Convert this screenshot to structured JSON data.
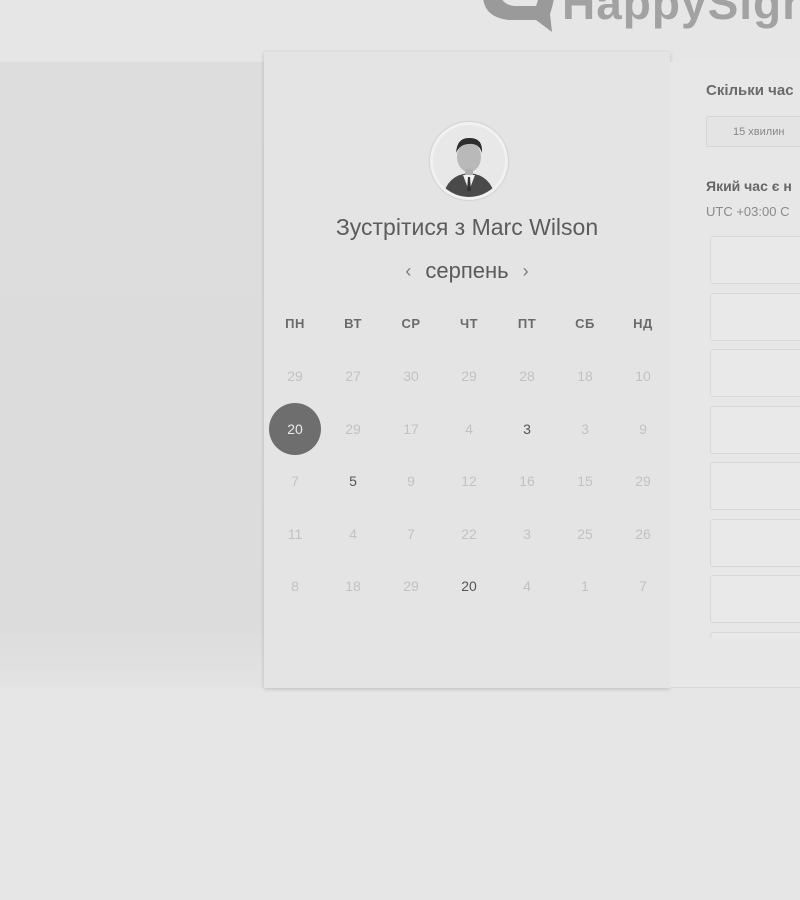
{
  "brand": {
    "name": "HappySign"
  },
  "host": {
    "title": "Зустрітися з Marc Wilson",
    "avatar_icon": "person-avatar-icon"
  },
  "calendar": {
    "month": "серпень",
    "prev_icon": "chevron-left-icon",
    "next_icon": "chevron-right-icon",
    "weekdays": [
      "ПН",
      "ВТ",
      "СР",
      "ЧТ",
      "ПТ",
      "СБ",
      "НД"
    ],
    "weeks": [
      [
        "29",
        "27",
        "30",
        "29",
        "28",
        "18",
        "10"
      ],
      [
        "20",
        "29",
        "17",
        "4",
        "3",
        "3",
        "9"
      ],
      [
        "7",
        "5",
        "9",
        "12",
        "16",
        "15",
        "29"
      ],
      [
        "11",
        "4",
        "7",
        "22",
        "3",
        "25",
        "26"
      ],
      [
        "8",
        "18",
        "29",
        "20",
        "4",
        "1",
        "7"
      ]
    ],
    "selected": "20",
    "selected_color": "#6e6e6e"
  },
  "booking": {
    "duration_question": "Скільки час",
    "duration_option": "15 хвилин",
    "time_question": "Який час є н",
    "timezone": "UTC +03:00 C"
  }
}
